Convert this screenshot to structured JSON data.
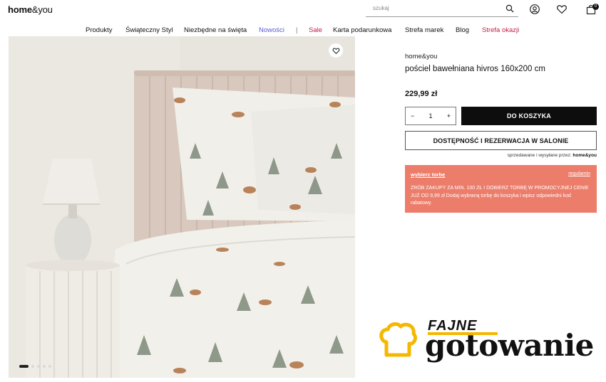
{
  "header": {
    "logo_bold": "home",
    "logo_rest": "&you",
    "search_placeholder": "szukaj",
    "cart_count": "0"
  },
  "nav": {
    "items": [
      "Produkty",
      "Świąteczny Styl",
      "Niezbędne na święta",
      "Nowości",
      "|",
      "Sale",
      "Karta podarunkowa",
      "Strefa marek",
      "Blog",
      "Strefa okazji"
    ]
  },
  "gallery": {
    "slide_count": 5,
    "active_slide": 1
  },
  "product": {
    "brand": "home&you",
    "name": "pościel bawełniana hivros 160x200 cm",
    "price": "229,99 zł",
    "quantity": "1",
    "qty_minus": "−",
    "qty_plus": "+",
    "add_to_cart": "DO KOSZYKA",
    "availability": "DOSTĘPNOŚĆ I REZERWACJA W SALONIE",
    "sold_by_prefix": "sprzedawane i wysyłane przez:",
    "sold_by": "home&you"
  },
  "promo": {
    "pick_bag": "wybierz torbę",
    "rules": "regulamin",
    "text": "ZRÓB ZAKUPY ZA MIN. 100 ZŁ I DOBIERZ TORBĘ W PROMOCYJNEJ CENIE JUŻ OD 9,99 zł Dodaj wybraną torbę do koszyka i wpisz odpowiedni kod rabatowy."
  },
  "watermark": {
    "line1": "FAJNE",
    "line2": "gotowanie"
  },
  "colors": {
    "promo_bg": "#ec7d6a",
    "nav_new": "#5a5ad6",
    "nav_sale": "#c0204a",
    "watermark_accent": "#f5b700"
  }
}
